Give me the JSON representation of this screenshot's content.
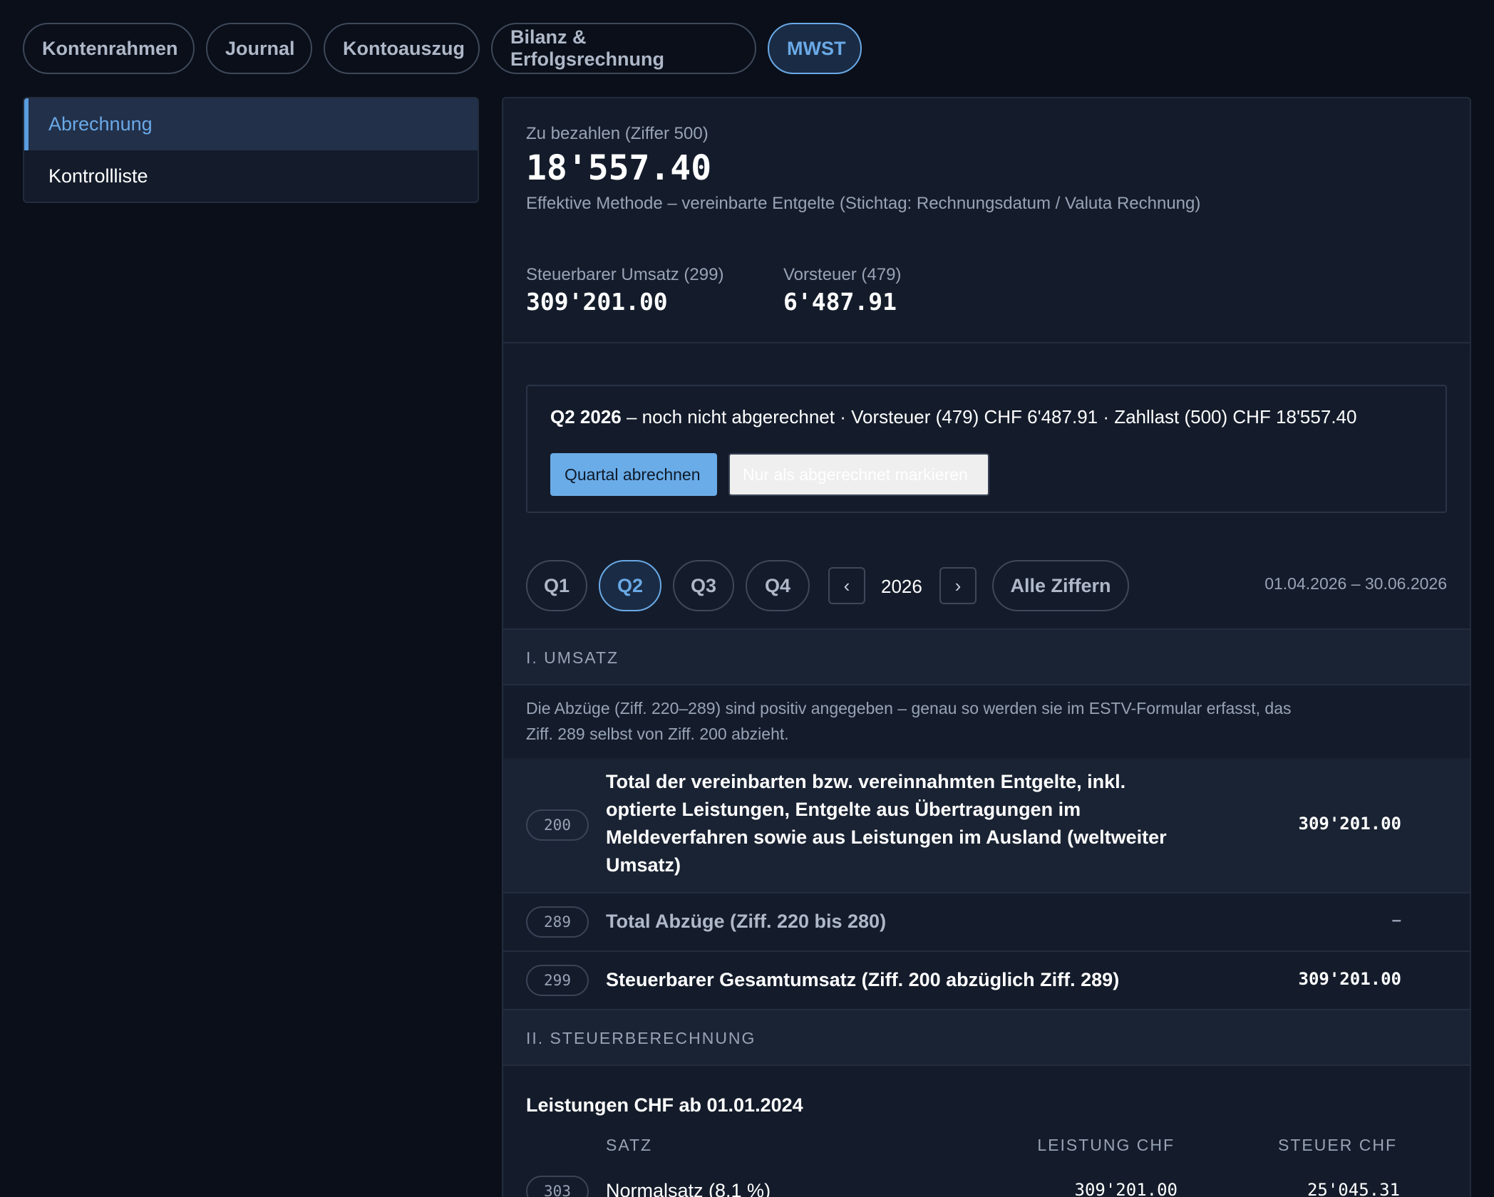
{
  "top_tabs": [
    {
      "label": "Kontenrahmen"
    },
    {
      "label": "Journal"
    },
    {
      "label": "Kontoauszug"
    },
    {
      "label": "Bilanz & Erfolgsrechnung"
    },
    {
      "label": "MWST",
      "active": true
    }
  ],
  "sidebar": {
    "items": [
      {
        "label": "Abrechnung",
        "active": true
      },
      {
        "label": "Kontrollliste"
      }
    ]
  },
  "summary": {
    "payable_label": "Zu bezahlen (Ziffer 500)",
    "payable_value": "18'557.40",
    "method": "Effektive Methode – vereinbarte Entgelte (Stichtag: Rechnungsdatum / Valuta Rechnung)",
    "turnover_label": "Steuerbarer Umsatz (299)",
    "turnover_value": "309'201.00",
    "input_tax_label": "Vorsteuer (479)",
    "input_tax_value": "6'487.91"
  },
  "notice": {
    "period": "Q2 2026",
    "text": " – noch nicht abgerechnet · Vorsteuer (479) CHF 6'487.91 · Zahllast (500) CHF 18'557.40",
    "primary_button": "Quartal abrechnen",
    "secondary_button": "Nur als abgerechnet markieren"
  },
  "period_selector": {
    "quarters": [
      "Q1",
      "Q2",
      "Q3",
      "Q4"
    ],
    "active_quarter": "Q2",
    "prev_icon": "chevron-left-icon",
    "next_icon": "chevron-right-icon",
    "prev_glyph": "‹",
    "next_glyph": "›",
    "year": "2026",
    "all_label": "Alle Ziffern",
    "date_range": "01.04.2026 – 30.06.2026"
  },
  "section_umsatz": {
    "title": "I. UMSATZ",
    "info": "Die Abzüge (Ziff. 220–289) sind positiv angegeben – genau so werden sie im ESTV-Formular erfasst, das Ziff. 289 selbst von Ziff. 200 abzieht.",
    "rows": [
      {
        "code": "200",
        "label": "Total der vereinbarten bzw. vereinnahmten Entgelte, inkl. optierte Leistungen, Entgelte aus Übertragungen im Meldeverfahren sowie aus Leistungen im Ausland (weltweiter Umsatz)",
        "value": "309'201.00"
      },
      {
        "code": "289",
        "label": "Total Abzüge (Ziff. 220 bis 280)",
        "value": "–"
      },
      {
        "code": "299",
        "label": "Steuerbarer Gesamtumsatz (Ziff. 200 abzüglich Ziff. 289)",
        "value": "309'201.00"
      }
    ]
  },
  "section_steuer": {
    "title": "II. STEUERBERECHNUNG",
    "subtitle": "Leistungen CHF ab 01.01.2024",
    "columns": {
      "rate": "SATZ",
      "service": "LEISTUNG CHF",
      "tax": "STEUER CHF"
    },
    "rows": [
      {
        "code": "303",
        "label": "Normalsatz (8.1 %)",
        "service": "309'201.00",
        "tax": "25'045.31"
      }
    ]
  },
  "colors": {
    "background": "#0a0f1a",
    "panel": "#141c2b",
    "accent": "#6aa9e6",
    "primary_button": "#6aace8"
  }
}
